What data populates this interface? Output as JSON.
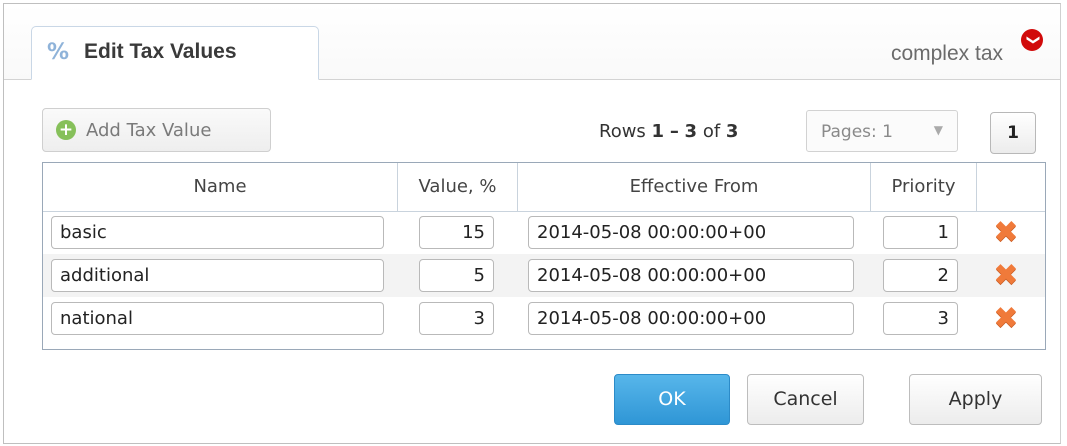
{
  "dialog": {
    "tab_icon": "%",
    "title": "Edit Tax Values",
    "subtitle": "complex tax",
    "collapse_icon": "❯"
  },
  "toolbar": {
    "add_label": "Add Tax Value",
    "rows_prefix": "Rows",
    "rows_from": "1",
    "rows_dash": "–",
    "rows_to": "3",
    "rows_of": "of",
    "rows_total": "3",
    "pages_label": "Pages: 1",
    "current_page": "1"
  },
  "table": {
    "columns": [
      "Name",
      "Value, %",
      "Effective From",
      "Priority"
    ],
    "rows": [
      {
        "name": "basic",
        "value": "15",
        "effective_from": "2014-05-08 00:00:00+00",
        "priority": "1"
      },
      {
        "name": "additional",
        "value": "5",
        "effective_from": "2014-05-08 00:00:00+00",
        "priority": "2"
      },
      {
        "name": "national",
        "value": "3",
        "effective_from": "2014-05-08 00:00:00+00",
        "priority": "3"
      }
    ]
  },
  "footer": {
    "ok_label": "OK",
    "cancel_label": "Cancel",
    "apply_label": "Apply"
  },
  "colors": {
    "accent": "#2f96d6",
    "delete": "#f07a3a",
    "collapse": "#d10a0a"
  }
}
